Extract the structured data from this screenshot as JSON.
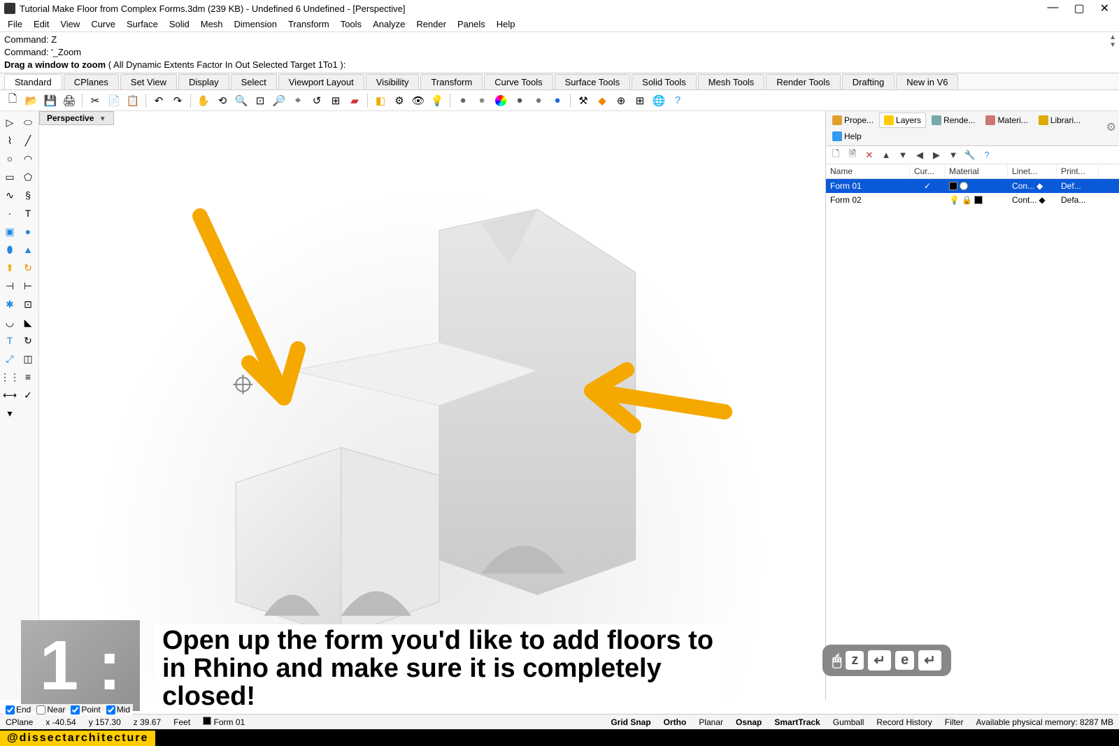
{
  "title": "Tutorial Make Floor from Complex Forms.3dm (239 KB) - Undefined 6 Undefined - [Perspective]",
  "menus": [
    "File",
    "Edit",
    "View",
    "Curve",
    "Surface",
    "Solid",
    "Mesh",
    "Dimension",
    "Transform",
    "Tools",
    "Analyze",
    "Render",
    "Panels",
    "Help"
  ],
  "command": {
    "line1": "Command: Z",
    "line2": "Command: '_Zoom",
    "prompt": "Drag a window to zoom",
    "opts_open": " ( ",
    "opts": [
      "All",
      "Dynamic",
      "Extents",
      "Factor",
      "In",
      "Out",
      "Selected",
      "Target",
      "1To1"
    ],
    "opts_close": " ):"
  },
  "main_tabs": [
    "Standard",
    "CPlanes",
    "Set View",
    "Display",
    "Select",
    "Viewport Layout",
    "Visibility",
    "Transform",
    "Curve Tools",
    "Surface Tools",
    "Solid Tools",
    "Mesh Tools",
    "Render Tools",
    "Drafting",
    "New in V6"
  ],
  "viewport_tab": "Perspective",
  "panel_tabs": [
    {
      "label": "Prope...",
      "icon": "#e0a030",
      "active": false
    },
    {
      "label": "Layers",
      "icon": "#ffcc00",
      "active": true
    },
    {
      "label": "Rende...",
      "icon": "#7aa",
      "active": false
    },
    {
      "label": "Materi...",
      "icon": "#c77",
      "active": false
    },
    {
      "label": "Librari...",
      "icon": "#da0",
      "active": false
    },
    {
      "label": "Help",
      "icon": "#39e",
      "active": false
    }
  ],
  "layer_header": {
    "name": "Name",
    "cur": "Cur...",
    "mat": "Material",
    "lin": "Linet...",
    "pri": "Print..."
  },
  "layers": [
    {
      "name": "Form 01",
      "selected": true,
      "current": "✓",
      "color": "#000000",
      "mat_circle": "#ffffff",
      "linetype": "Con...",
      "linecol": "#ffffff",
      "print": "Def..."
    },
    {
      "name": "Form 02",
      "selected": false,
      "current": "",
      "color": "#000000",
      "mat_circle": "",
      "linetype": "Cont...",
      "linecol": "#000000",
      "print": "Defa..."
    }
  ],
  "osnap": [
    {
      "label": "End",
      "checked": true
    },
    {
      "label": "Near",
      "checked": false
    },
    {
      "label": "Point",
      "checked": true
    },
    {
      "label": "Mid",
      "checked": true
    }
  ],
  "status": {
    "cplane": "CPlane",
    "x": "x -40.54",
    "y": "y 157.30",
    "z": "z 39.67",
    "units": "Feet",
    "layer": "Form 01",
    "gridsnap": "Grid Snap",
    "ortho": "Ortho",
    "planar": "Planar",
    "osnap": "Osnap",
    "smarttrack": "SmartTrack",
    "gumball": "Gumball",
    "record": "Record History",
    "filter": "Filter",
    "mem": "Available physical memory: 8287 MB"
  },
  "overlay": {
    "step": "1 :",
    "text": "Open up the form you'd like to add floors to in Rhino and make sure it is completely closed!"
  },
  "keyhint": [
    "z",
    "↵",
    "e",
    "↵"
  ],
  "handle": "@dissectarchitecture"
}
